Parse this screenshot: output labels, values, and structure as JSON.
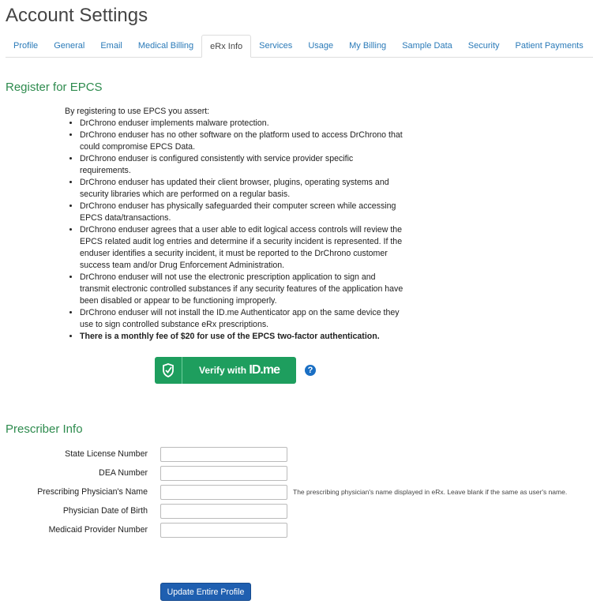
{
  "title": "Account Settings",
  "tabs": [
    {
      "label": "Profile"
    },
    {
      "label": "General"
    },
    {
      "label": "Email"
    },
    {
      "label": "Medical Billing"
    },
    {
      "label": "eRx Info",
      "active": true
    },
    {
      "label": "Services"
    },
    {
      "label": "Usage"
    },
    {
      "label": "My Billing"
    },
    {
      "label": "Sample Data"
    },
    {
      "label": "Security"
    },
    {
      "label": "Patient Payments"
    }
  ],
  "epcs": {
    "heading": "Register for EPCS",
    "intro": "By registering to use EPCS you assert:",
    "items": [
      "DrChrono enduser implements malware protection.",
      "DrChrono enduser has no other software on the platform used to access DrChrono that could compromise EPCS Data.",
      "DrChrono enduser is configured consistently with service provider specific requirements.",
      "DrChrono enduser has updated their client browser, plugins, operating systems and security libraries which are performed on a regular basis.",
      "DrChrono enduser has physically safeguarded their computer screen while accessing EPCS data/transactions.",
      "DrChrono enduser agrees that a user able to edit logical access controls will review the EPCS related audit log entries and determine if a security incident is represented. If the enduser identifies a security incident, it must be reported to the DrChrono customer success team and/or Drug Enforcement Administration.",
      "DrChrono enduser will not use the electronic prescription application to sign and transmit electronic controlled substances if any security features of the application have been disabled or appear to be functioning improperly.",
      "DrChrono enduser will not install the ID.me Authenticator app on the same device they use to sign controlled substance eRx prescriptions."
    ],
    "fee": "There is a monthly fee of $20 for use of the EPCS two-factor authentication.",
    "verify_label": "Verify with",
    "verify_brand": "ID.me",
    "help": "?"
  },
  "prescriber": {
    "heading": "Prescriber Info",
    "fields": [
      {
        "label": "State License Number",
        "value": ""
      },
      {
        "label": "DEA Number",
        "value": ""
      },
      {
        "label": "Prescribing Physician's Name",
        "value": "",
        "hint": "The prescribing physician's name displayed in eRx. Leave blank if the same as user's name."
      },
      {
        "label": "Physician Date of Birth",
        "value": ""
      },
      {
        "label": "Medicaid Provider Number",
        "value": ""
      }
    ]
  },
  "update_label": "Update Entire Profile",
  "colors": {
    "accent_green": "#2e8b4e",
    "link": "#2a7ab8",
    "button_blue": "#1f5fb0",
    "idme_green": "#1e9e5e"
  }
}
